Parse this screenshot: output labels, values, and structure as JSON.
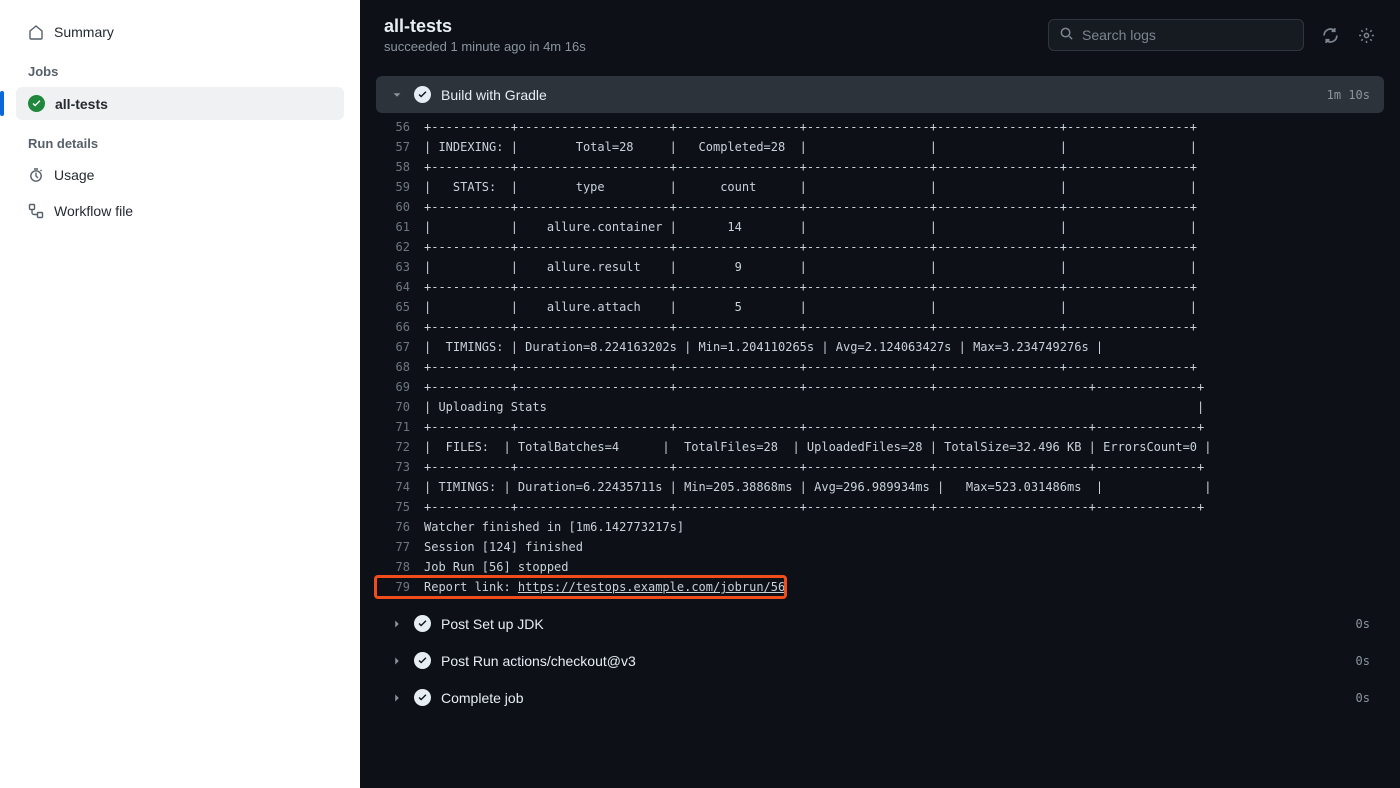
{
  "sidebar": {
    "summary": "Summary",
    "jobs_heading": "Jobs",
    "job_name": "all-tests",
    "details_heading": "Run details",
    "usage": "Usage",
    "workflow_file": "Workflow file"
  },
  "header": {
    "title": "all-tests",
    "status": "succeeded",
    "time_ago": "1 minute ago",
    "in_word": "in",
    "duration": "4m 16s",
    "search_placeholder": "Search logs"
  },
  "steps": {
    "expanded": {
      "name": "Build with Gradle",
      "duration": "1m 10s"
    },
    "post_jdk": {
      "name": "Post Set up JDK",
      "duration": "0s"
    },
    "post_checkout": {
      "name": "Post Run actions/checkout@v3",
      "duration": "0s"
    },
    "complete": {
      "name": "Complete job",
      "duration": "0s"
    }
  },
  "log": {
    "lines": [
      {
        "n": 56,
        "t": "+-----------+---------------------+-----------------+-----------------+-----------------+-----------------+"
      },
      {
        "n": 57,
        "t": "| INDEXING: |        Total=28     |   Completed=28  |                 |                 |                 |"
      },
      {
        "n": 58,
        "t": "+-----------+---------------------+-----------------+-----------------+-----------------+-----------------+"
      },
      {
        "n": 59,
        "t": "|   STATS:  |        type         |      count      |                 |                 |                 |"
      },
      {
        "n": 60,
        "t": "+-----------+---------------------+-----------------+-----------------+-----------------+-----------------+"
      },
      {
        "n": 61,
        "t": "|           |    allure.container |       14        |                 |                 |                 |"
      },
      {
        "n": 62,
        "t": "+-----------+---------------------+-----------------+-----------------+-----------------+-----------------+"
      },
      {
        "n": 63,
        "t": "|           |    allure.result    |        9        |                 |                 |                 |"
      },
      {
        "n": 64,
        "t": "+-----------+---------------------+-----------------+-----------------+-----------------+-----------------+"
      },
      {
        "n": 65,
        "t": "|           |    allure.attach    |        5        |                 |                 |                 |"
      },
      {
        "n": 66,
        "t": "+-----------+---------------------+-----------------+-----------------+-----------------+-----------------+"
      },
      {
        "n": 67,
        "t": "|  TIMINGS: | Duration=8.224163202s | Min=1.204110265s | Avg=2.124063427s | Max=3.234749276s |"
      },
      {
        "n": 68,
        "t": "+-----------+---------------------+-----------------+-----------------+-----------------+-----------------+"
      },
      {
        "n": 69,
        "t": "+-----------+---------------------+-----------------+-----------------+---------------------+--------------+"
      },
      {
        "n": 70,
        "t": "| Uploading Stats                                                                                          |"
      },
      {
        "n": 71,
        "t": "+-----------+---------------------+-----------------+-----------------+---------------------+--------------+"
      },
      {
        "n": 72,
        "t": "|  FILES:  | TotalBatches=4      |  TotalFiles=28  | UploadedFiles=28 | TotalSize=32.496 KB | ErrorsCount=0 |"
      },
      {
        "n": 73,
        "t": "+-----------+---------------------+-----------------+-----------------+---------------------+--------------+"
      },
      {
        "n": 74,
        "t": "| TIMINGS: | Duration=6.22435711s | Min=205.38868ms | Avg=296.989934ms |   Max=523.031486ms  |              |"
      },
      {
        "n": 75,
        "t": "+-----------+---------------------+-----------------+-----------------+---------------------+--------------+"
      },
      {
        "n": 76,
        "t": "Watcher finished in [1m6.142773217s]"
      },
      {
        "n": 77,
        "t": "Session [124] finished"
      },
      {
        "n": 78,
        "t": "Job Run [56] stopped"
      }
    ],
    "highlight": {
      "n": 79,
      "prefix": "Report link: ",
      "link": "https://testops.example.com/jobrun/56"
    }
  }
}
